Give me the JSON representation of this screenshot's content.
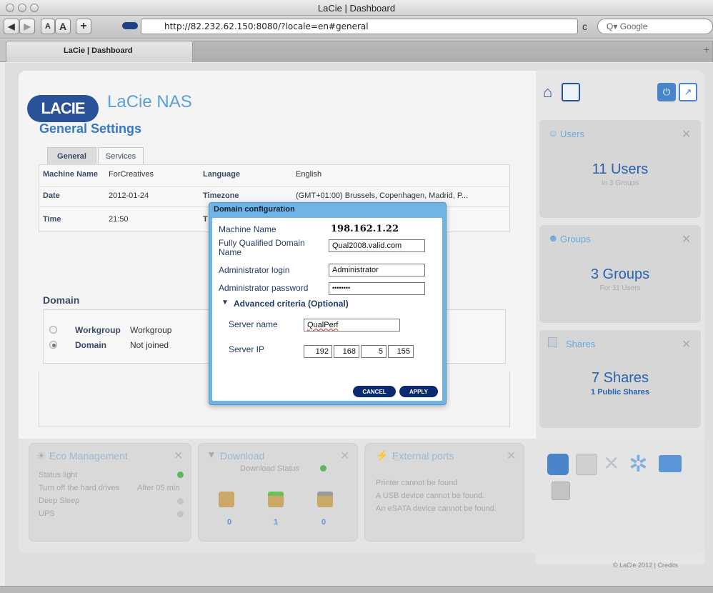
{
  "window": {
    "title": "LaCie | Dashboard"
  },
  "toolbar": {
    "back": "◀",
    "forward": "▶",
    "text_small": "A",
    "text_large": "A",
    "add": "+",
    "url": "http://82.232.62.150:8080/?locale=en#general",
    "reload": "c",
    "search_placeholder": "Q▾ Google"
  },
  "tabs": {
    "active_label": "LaCie | Dashboard",
    "new_tab": "+"
  },
  "brand": {
    "logo": "LACIE",
    "name": "LaCie NAS"
  },
  "page": {
    "title": "General Settings",
    "tabs": [
      "General",
      "Services"
    ]
  },
  "settings": {
    "machine_name_label": "Machine Name",
    "machine_name": "ForCreatives",
    "date_label": "Date",
    "date": "2012-01-24",
    "time_label": "Time",
    "time": "21:50",
    "language_label": "Language",
    "language": "English",
    "timezone_label": "Timezone",
    "timezone": "(GMT+01:00) Brussels, Copenhagen, Madrid, P...",
    "hidden_label_initial": "T"
  },
  "domain": {
    "heading": "Domain",
    "options": [
      {
        "label": "Workgroup",
        "value": "Workgroup",
        "selected": false
      },
      {
        "label": "Domain",
        "value": "Not joined",
        "selected": true
      }
    ]
  },
  "modal": {
    "title": "Domain configuration",
    "machine_name_label": "Machine Name",
    "machine_name_value": "198.162.1.22",
    "fqdn_label": "Fully Qualified Domain Name",
    "fqdn_value": "Qual2008.valid.com",
    "admin_login_label": "Administrator login",
    "admin_login_value": "Administrator",
    "admin_password_label": "Administrator password",
    "admin_password_value": "••••••••",
    "advanced_label": "Advanced criteria (Optional)",
    "server_name_label": "Server name",
    "server_name_value": "QualPerf",
    "server_ip_label": "Server IP",
    "server_ip": [
      "192",
      "168",
      "5",
      "155"
    ],
    "cancel": "CANCEL",
    "apply": "APPLY"
  },
  "widgets": {
    "users": {
      "title": "Users",
      "count": "11 Users",
      "sub": "In 3 Groups"
    },
    "groups": {
      "title": "Groups",
      "count": "3 Groups",
      "sub": "For 11 Users"
    },
    "shares": {
      "title": "Shares",
      "count": "7 Shares",
      "sub": "1 Public Shares"
    }
  },
  "eco": {
    "title": "Eco Management",
    "rows": [
      {
        "label": "Status light",
        "value": ""
      },
      {
        "label": "Turn off the hard drives",
        "value": "After 05 min"
      },
      {
        "label": "Deep Sleep",
        "value": ""
      },
      {
        "label": "UPS",
        "value": ""
      }
    ]
  },
  "download": {
    "title": "Download",
    "status": "Download Status",
    "counts": [
      "0",
      "1",
      "0"
    ]
  },
  "external": {
    "title": "External ports",
    "lines": [
      "Printer cannot be found",
      "A USB device cannot be found.",
      "An eSATA device cannot be found."
    ]
  },
  "footer": {
    "text": "© LaCie 2012 | Credits"
  },
  "colors": {
    "accent": "#3578c6",
    "modal_frame": "#6fb4e6",
    "button": "#0c2a6e",
    "green": "#5cb85c"
  }
}
